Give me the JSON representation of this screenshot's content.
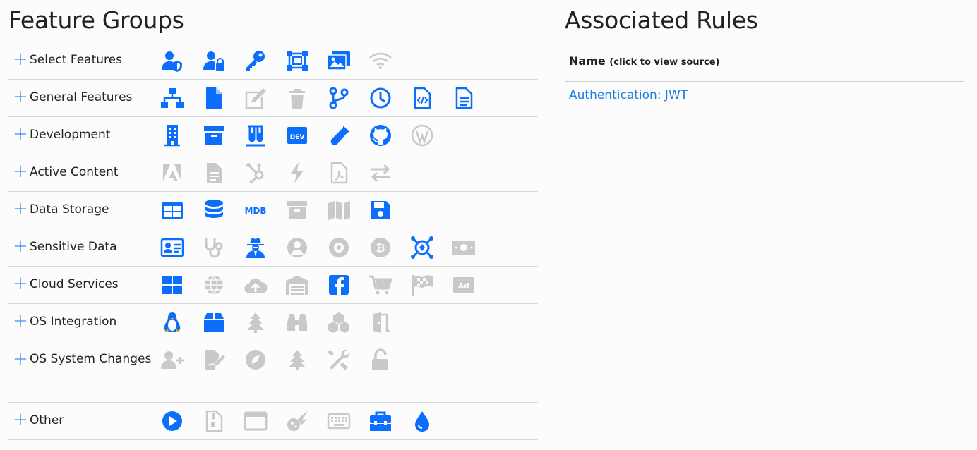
{
  "feature_groups": {
    "title": "Feature Groups",
    "rows": [
      {
        "label": "Select Features",
        "icons": [
          {
            "name": "user-shield-icon",
            "on": true
          },
          {
            "name": "user-lock-icon",
            "on": true
          },
          {
            "name": "key-icon",
            "on": true
          },
          {
            "name": "object-selection-icon",
            "on": true
          },
          {
            "name": "images-icon",
            "on": true
          },
          {
            "name": "wifi-icon",
            "on": false
          }
        ]
      },
      {
        "label": "General Features",
        "icons": [
          {
            "name": "network-icon",
            "on": true
          },
          {
            "name": "file-icon",
            "on": true
          },
          {
            "name": "edit-icon",
            "on": false
          },
          {
            "name": "trash-icon",
            "on": false
          },
          {
            "name": "code-branch-icon",
            "on": true
          },
          {
            "name": "clock-icon",
            "on": true
          },
          {
            "name": "file-code-icon",
            "on": true
          },
          {
            "name": "file-alt-icon",
            "on": true
          }
        ]
      },
      {
        "label": "Development",
        "icons": [
          {
            "name": "building-icon",
            "on": true
          },
          {
            "name": "archive-icon",
            "on": true
          },
          {
            "name": "vials-icon",
            "on": true
          },
          {
            "name": "dev-icon",
            "on": true
          },
          {
            "name": "vial-icon",
            "on": true
          },
          {
            "name": "github-icon",
            "on": true
          },
          {
            "name": "wordpress-icon",
            "on": false
          }
        ]
      },
      {
        "label": "Active Content",
        "icons": [
          {
            "name": "adobe-icon",
            "on": false
          },
          {
            "name": "file-document-icon",
            "on": false
          },
          {
            "name": "hubspot-icon",
            "on": false
          },
          {
            "name": "bolt-icon",
            "on": false
          },
          {
            "name": "file-pdf-icon",
            "on": false
          },
          {
            "name": "exchange-icon",
            "on": false
          }
        ]
      },
      {
        "label": "Data Storage",
        "icons": [
          {
            "name": "table-icon",
            "on": true
          },
          {
            "name": "database-icon",
            "on": true
          },
          {
            "name": "mdb-icon",
            "on": true
          },
          {
            "name": "archive-icon",
            "on": false
          },
          {
            "name": "map-icon",
            "on": false
          },
          {
            "name": "save-icon",
            "on": true
          }
        ]
      },
      {
        "label": "Sensitive Data",
        "icons": [
          {
            "name": "id-card-icon",
            "on": true
          },
          {
            "name": "stethoscope-icon",
            "on": false
          },
          {
            "name": "user-secret-icon",
            "on": true
          },
          {
            "name": "user-circle-icon",
            "on": false
          },
          {
            "name": "record-icon",
            "on": false
          },
          {
            "name": "bitcoin-icon",
            "on": false
          },
          {
            "name": "satellite-icon",
            "on": true
          },
          {
            "name": "money-bill-icon",
            "on": false
          }
        ]
      },
      {
        "label": "Cloud Services",
        "icons": [
          {
            "name": "windows-icon",
            "on": true
          },
          {
            "name": "globe-icon",
            "on": false
          },
          {
            "name": "cloud-upload-icon",
            "on": false
          },
          {
            "name": "warehouse-icon",
            "on": false
          },
          {
            "name": "facebook-icon",
            "on": true
          },
          {
            "name": "cart-icon",
            "on": false
          },
          {
            "name": "flag-checkered-icon",
            "on": false
          },
          {
            "name": "ad-icon",
            "on": false
          }
        ]
      },
      {
        "label": "OS Integration",
        "icons": [
          {
            "name": "linux-icon",
            "on": true
          },
          {
            "name": "box-icon",
            "on": true
          },
          {
            "name": "tree-icon",
            "on": false
          },
          {
            "name": "binoculars-icon",
            "on": false
          },
          {
            "name": "cubes-icon",
            "on": false
          },
          {
            "name": "door-open-icon",
            "on": false
          }
        ]
      },
      {
        "label": "OS System Changes",
        "icons": [
          {
            "name": "user-plus-icon",
            "on": false
          },
          {
            "name": "file-signature-icon",
            "on": false
          },
          {
            "name": "compass-icon",
            "on": false
          },
          {
            "name": "tree-icon",
            "on": false
          },
          {
            "name": "tools-icon",
            "on": false
          },
          {
            "name": "unlock-icon",
            "on": false
          }
        ]
      },
      {
        "label": "Other",
        "icons": [
          {
            "name": "play-circle-icon",
            "on": true
          },
          {
            "name": "file-archive-icon",
            "on": false
          },
          {
            "name": "window-icon",
            "on": false
          },
          {
            "name": "meteor-icon",
            "on": false
          },
          {
            "name": "keyboard-icon",
            "on": false
          },
          {
            "name": "toolbox-icon",
            "on": true
          },
          {
            "name": "tint-icon",
            "on": true
          }
        ]
      }
    ]
  },
  "associated_rules": {
    "title": "Associated Rules",
    "name_header": "Name",
    "name_hint": "(click to view source)",
    "rules": [
      "Authentication: JWT"
    ]
  },
  "colors": {
    "active": "#0b6efd",
    "inactive": "#c9c9c9",
    "link": "#1a7ee0"
  }
}
